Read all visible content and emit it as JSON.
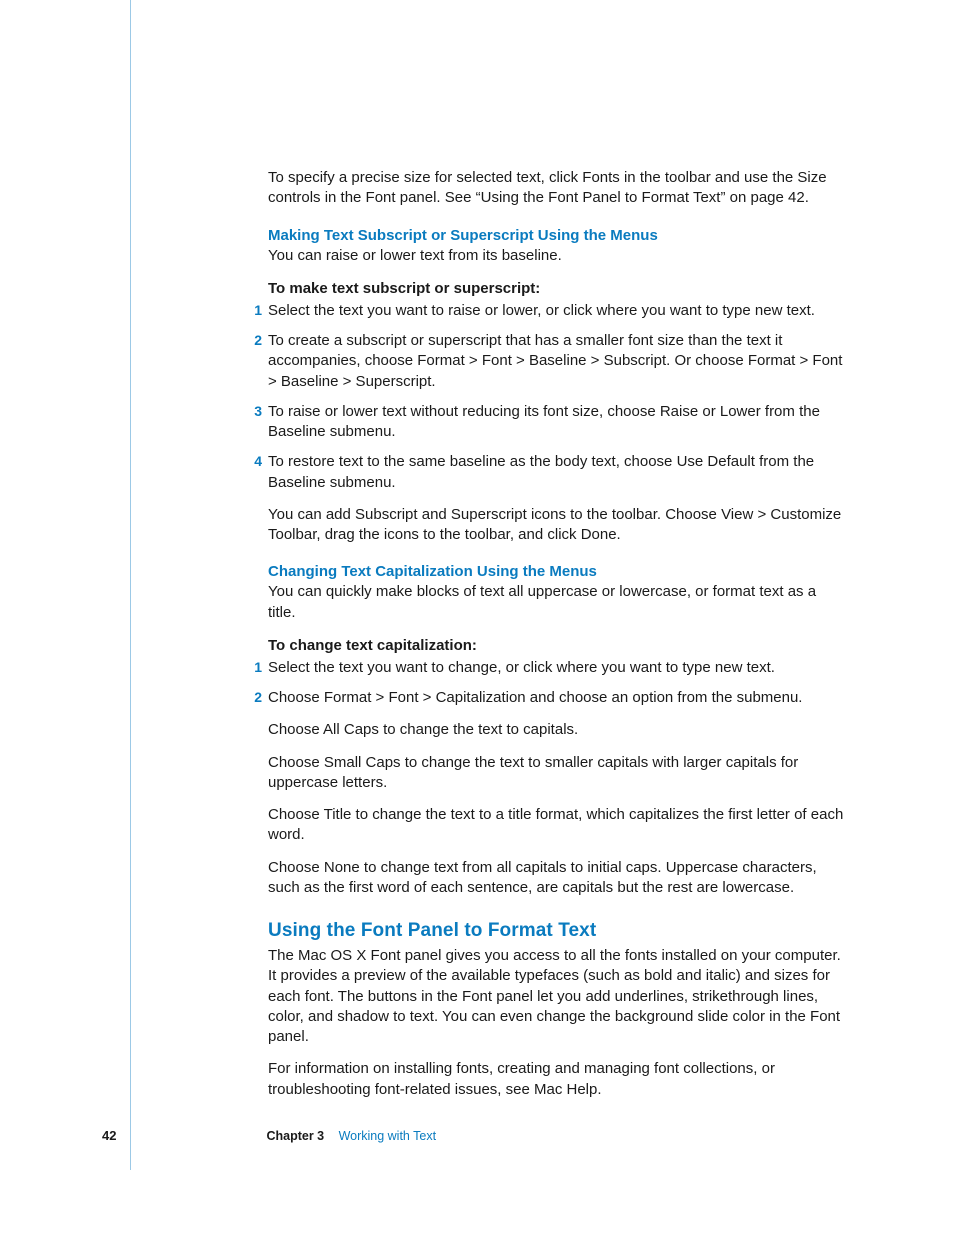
{
  "intro_para": "To specify a precise size for selected text, click Fonts in the toolbar and use the Size controls in the Font panel. See “Using the Font Panel to Format Text” on page 42.",
  "sec1": {
    "heading": "Making Text Subscript or Superscript Using the Menus",
    "lede": "You can raise or lower text from its baseline.",
    "task_label": "To make text subscript or superscript:",
    "steps": [
      "Select the text you want to raise or lower, or click where you want to type new text.",
      "To create a subscript or superscript that has a smaller font size than the text it accompanies, choose Format > Font > Baseline > Subscript. Or choose Format > Font > Baseline > Superscript.",
      "To raise or lower text without reducing its font size, choose Raise or Lower from the Baseline submenu.",
      "To restore text to the same baseline as the body text, choose Use Default from the Baseline submenu."
    ],
    "note": "You can add Subscript and Superscript icons to the toolbar. Choose View > Customize Toolbar, drag the icons to the toolbar, and click Done."
  },
  "sec2": {
    "heading": "Changing Text Capitalization Using the Menus",
    "lede": "You can quickly make blocks of text all uppercase or lowercase, or format text as a title.",
    "task_label": "To change text capitalization:",
    "steps": [
      "Select the text you want to change, or click where you want to type new text.",
      "Choose Format > Font > Capitalization and choose an option from the submenu."
    ],
    "subs": [
      "Choose All Caps to change the text to capitals.",
      "Choose Small Caps to change the text to smaller capitals with larger capitals for uppercase letters.",
      "Choose Title to change the text to a title format, which capitalizes the first letter of each word.",
      "Choose None to change text from all capitals to initial caps. Uppercase characters, such as the first word of each sentence, are capitals but the rest are lowercase."
    ]
  },
  "sec3": {
    "heading": "Using the Font Panel to Format Text",
    "para1": "The Mac OS X Font panel gives you access to all the fonts installed on your computer. It provides a preview of the available typefaces (such as bold and italic) and sizes for each font. The buttons in the Font panel let you add underlines, strikethrough lines, color, and shadow to text. You can even change the background slide color in the Font panel.",
    "para2": "For information on installing fonts, creating and managing font collections, or troubleshooting font-related issues, see Mac Help."
  },
  "footer": {
    "page": "42",
    "chapter_label": "Chapter 3",
    "chapter_title": "Working with Text"
  },
  "nums": {
    "n1": "1",
    "n2": "2",
    "n3": "3",
    "n4": "4"
  }
}
